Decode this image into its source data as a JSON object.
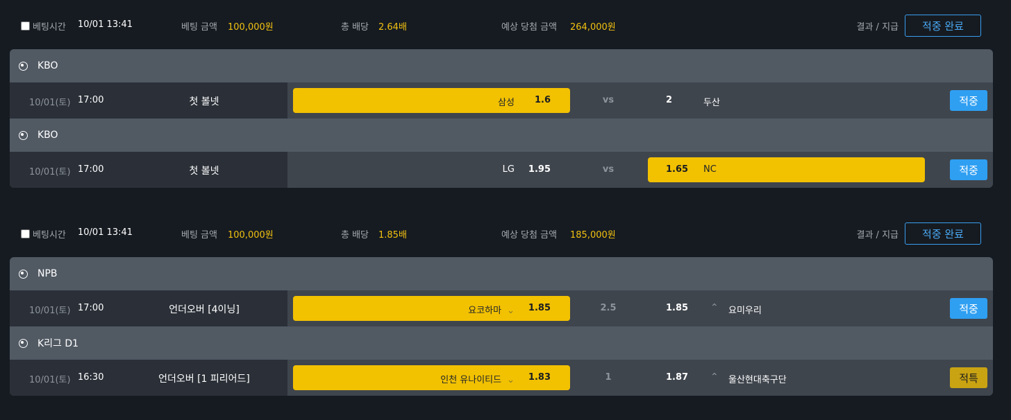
{
  "slips": [
    {
      "bet_time_label": "베팅시간",
      "bet_time": "10/01 13:41",
      "amount_label": "베팅 금액",
      "amount": "100,000원",
      "odds_label": "총 배당",
      "odds": "2.64배",
      "expected_label": "예상 당첨 금액",
      "expected": "264,000원",
      "result_label": "결과 / 지급",
      "result_button": "적중 완료",
      "games": [
        {
          "league": "KBO",
          "date": "10/01(토)",
          "time": "17:00",
          "market": "첫 볼넷",
          "home": "삼성",
          "home_odds": "1.6",
          "mid": "vs",
          "away_odds": "2",
          "away": "두산",
          "selected": "home",
          "status": "적중"
        },
        {
          "league": "KBO",
          "date": "10/01(토)",
          "time": "17:00",
          "market": "첫 볼넷",
          "home": "LG",
          "home_odds": "1.95",
          "mid": "vs",
          "away_odds": "1.65",
          "away": "NC",
          "selected": "away",
          "status": "적중"
        }
      ]
    },
    {
      "bet_time_label": "베팅시간",
      "bet_time": "10/01 13:41",
      "amount_label": "베팅 금액",
      "amount": "100,000원",
      "odds_label": "총 배당",
      "odds": "1.85배",
      "expected_label": "예상 당첨 금액",
      "expected": "185,000원",
      "result_label": "결과 / 지급",
      "result_button": "적중 완료",
      "games": [
        {
          "league": "NPB",
          "date": "10/01(토)",
          "time": "17:00",
          "market": "언더오버 [4이닝]",
          "home": "요코하마",
          "home_odds": "1.85",
          "mid": "2.5",
          "away_odds": "1.85",
          "away": "요미우리",
          "selected": "home",
          "status": "적중"
        },
        {
          "league": "K리그 D1",
          "date": "10/01(토)",
          "time": "16:30",
          "market": "언더오버 [1 피리어드]",
          "home": "인천 유나이티드",
          "home_odds": "1.83",
          "mid": "1",
          "away_odds": "1.87",
          "away": "울산현대축구단",
          "selected": "home",
          "status": "적특"
        }
      ]
    }
  ],
  "icons": {
    "under": "chevrons-down-icon",
    "over": "chevrons-up-icon"
  },
  "colors": {
    "selected": "#f2c100",
    "win_badge": "#2f9ff2",
    "refund_badge": "#c9a312",
    "gold_text": "#f2c110"
  }
}
